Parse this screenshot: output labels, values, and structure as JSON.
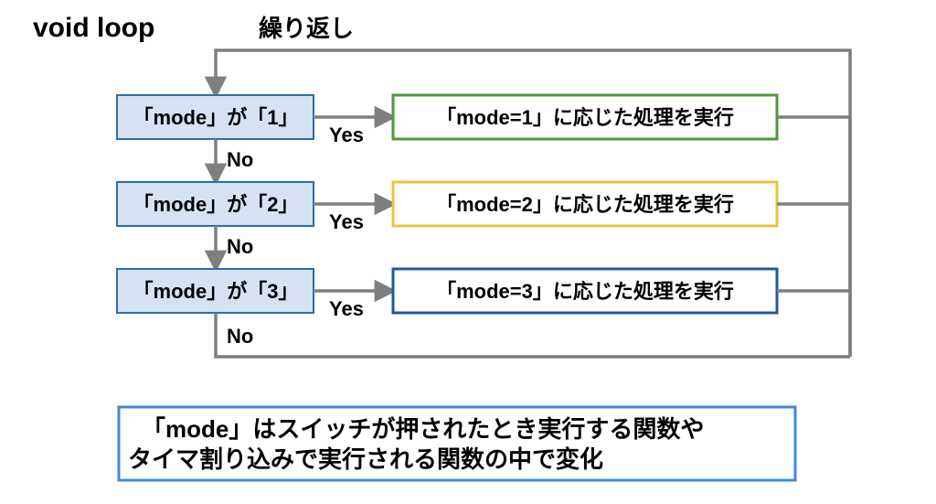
{
  "title": "void loop",
  "loop_label": "繰り返し",
  "labels": {
    "yes": "Yes",
    "no": "No"
  },
  "conditions": [
    {
      "text": "「mode」が「1」"
    },
    {
      "text": "「mode」が「2」"
    },
    {
      "text": "「mode」が「3」"
    }
  ],
  "actions": [
    {
      "text": "「mode=1」に応じた処理を実行",
      "color": "green"
    },
    {
      "text": "「mode=2」に応じた処理を実行",
      "color": "yellow"
    },
    {
      "text": "「mode=3」に応じた処理を実行",
      "color": "blue"
    }
  ],
  "note": {
    "line1": "「mode」はスイッチが押されたとき実行する関数や",
    "line2": "タイマ割り込みで実行される関数の中で変化"
  }
}
